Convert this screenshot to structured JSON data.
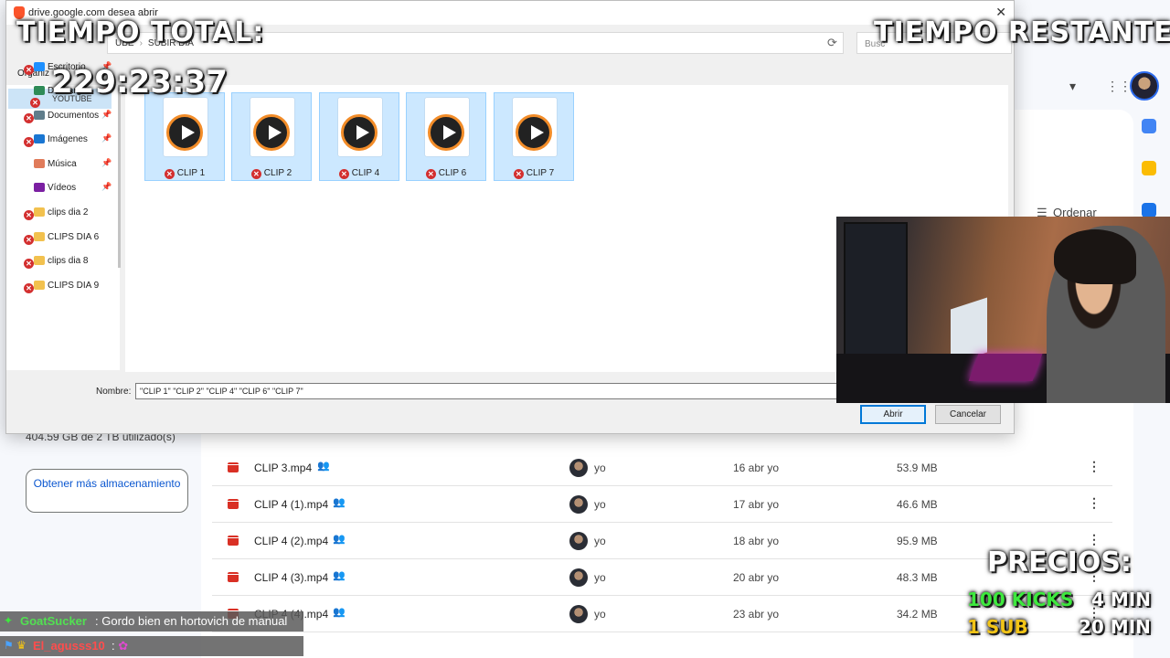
{
  "dialog": {
    "title": "drive.google.com desea abrir",
    "breadcrumb": [
      "UBE",
      "SUBIR DIA"
    ],
    "search_placeholder": "Busc",
    "organize_label": "Organiz",
    "nav_top_label": "YOUTUBE",
    "nav_items": [
      {
        "label": "Escritorio",
        "pinned": true,
        "color": "#1e90ff"
      },
      {
        "label": "Descargas",
        "pinned": true,
        "color": "#2e8b57"
      },
      {
        "label": "Documentos",
        "pinned": true,
        "color": "#607d8b"
      },
      {
        "label": "Imágenes",
        "pinned": true,
        "color": "#1976d2"
      },
      {
        "label": "Música",
        "pinned": true,
        "color": "#e07b5a"
      },
      {
        "label": "Vídeos",
        "pinned": true,
        "color": "#7b1fa2"
      },
      {
        "label": "clips dia 2",
        "pinned": false,
        "color": "#f2c14e"
      },
      {
        "label": "CLIPS DIA 6",
        "pinned": false,
        "color": "#f2c14e"
      },
      {
        "label": "clips dia 8",
        "pinned": false,
        "color": "#f2c14e"
      },
      {
        "label": "CLIPS DIA 9",
        "pinned": false,
        "color": "#f2c14e"
      }
    ],
    "files": [
      "CLIP 1",
      "CLIP 2",
      "CLIP 4",
      "CLIP 6",
      "CLIP 7"
    ],
    "name_label": "Nombre:",
    "name_value": "\"CLIP 1\" \"CLIP 2\" \"CLIP 4\" \"CLIP 6\" \"CLIP 7\"",
    "open_button": "Abrir",
    "cancel_button": "Cancelar"
  },
  "drive": {
    "storage_text": "404.59 GB de 2 TB utilizado(s)",
    "storage_button": "Obtener más almacenamiento",
    "sort_label": "Ordenar",
    "files": [
      {
        "name": "CLIP 3.mp4",
        "owner": "yo",
        "date": "16 abr yo",
        "size": "53.9 MB"
      },
      {
        "name": "CLIP 4 (1).mp4",
        "owner": "yo",
        "date": "17 abr yo",
        "size": "46.6 MB"
      },
      {
        "name": "CLIP 4 (2).mp4",
        "owner": "yo",
        "date": "18 abr yo",
        "size": "95.9 MB"
      },
      {
        "name": "CLIP 4 (3).mp4",
        "owner": "yo",
        "date": "20 abr yo",
        "size": "48.3 MB"
      },
      {
        "name": "CLIP 4 (4).mp4",
        "owner": "yo",
        "date": "23 abr yo",
        "size": "34.2 MB"
      }
    ]
  },
  "overlay": {
    "total_label": "TIEMPO TOTAL:",
    "total_time": "229:23:37",
    "remaining_label": "TIEMPO RESTANTE:",
    "prices_label": "PRECIOS:",
    "price_kicks": "100 KICKS",
    "price_kicks_time": "4 MIN",
    "price_sub": "1 SUB",
    "price_sub_time": "20 MIN"
  },
  "chat": [
    {
      "user": "GoatSucker",
      "message": "Gordo bien en hortovich de manual",
      "user_color": "#52e052"
    },
    {
      "user": "El_agusss10",
      "message": "",
      "user_color": "#ff4d4d"
    }
  ]
}
